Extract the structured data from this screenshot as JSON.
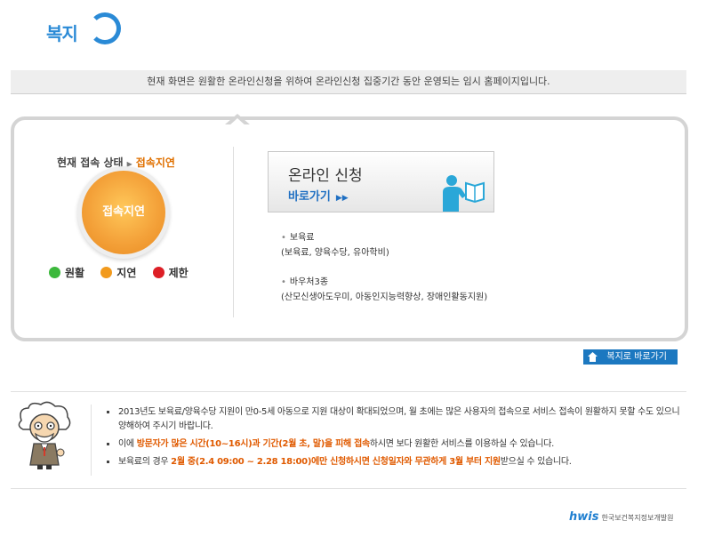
{
  "logo": {
    "text": "복지",
    "color": "#2a8ad6"
  },
  "notice_bar": {
    "text": "현재 화면은 원활한 온라인신청을 위하여 온라인신청 집중기간 동안 운영되는 임시 홈페이지입니다."
  },
  "status": {
    "label": "현재 접속 상태",
    "value": "접속지연",
    "circle_text": "접속지연",
    "value_color": "#e07000"
  },
  "legend": [
    {
      "label": "원활",
      "color": "#3cb83c"
    },
    {
      "label": "지연",
      "color": "#f29a1d"
    },
    {
      "label": "제한",
      "color": "#dd1f26"
    }
  ],
  "apply": {
    "title": "온라인 신청",
    "subtitle": "바로가기",
    "icon": "person-reading-icon"
  },
  "info": [
    {
      "title": "보육료",
      "detail": "(보육료, 양육수당, 유아학비)"
    },
    {
      "title": "바우처3종",
      "detail": "(산모신생아도우미, 아동인지능력향상, 장애인활동지원)"
    }
  ],
  "shortcut": {
    "label": "복지로 바로가기",
    "icon": "home-icon"
  },
  "notices": {
    "n1": "2013년도 보육료/양육수당 지원이 만0-5세 아동으로 지원 대상이 확대되었으며, 월 초에는 많은 사용자의 접속으로 서비스 접속이 원활하지 못할 수도 있으니 양해하여 주시기 바랍니다.",
    "n2_a": "이에 ",
    "n2_b": "방문자가 많은 시간(10~16시)과 기간(2월 초, 말)을 피해 접속",
    "n2_c": "하시면 보다 원활한 서비스를 이용하실 수 있습니다.",
    "n3_a": "보육료의 경우 ",
    "n3_b": "2월 중(2.4 09:00 ~ 2.28 18:00)에만 신청하시면 신청일자와 무관하게 3월 부터 지원",
    "n3_c": "받으실 수 있습니다."
  },
  "footer": {
    "brand": "hwis",
    "org": "한국보건복지정보개발원"
  }
}
